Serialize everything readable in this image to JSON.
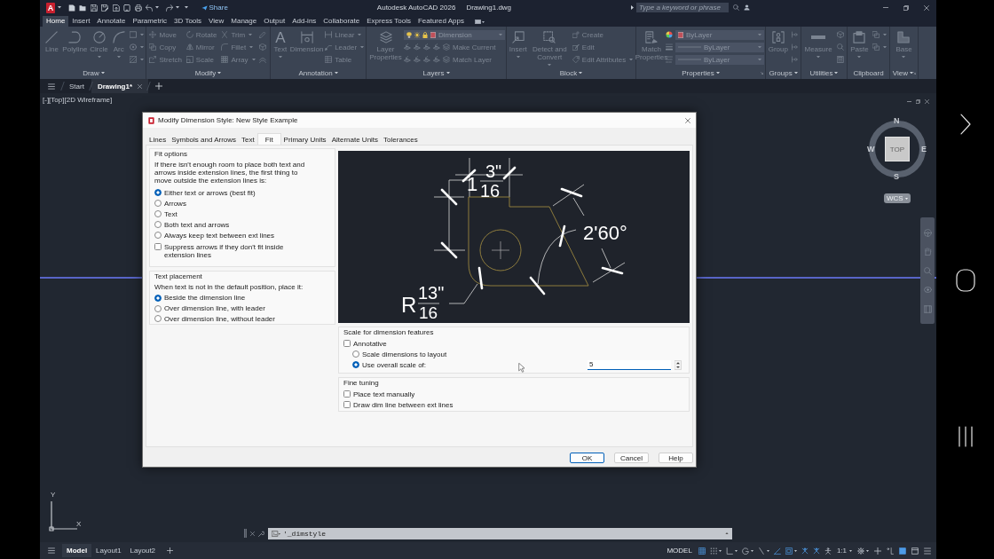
{
  "title_bar": {
    "logo": "A",
    "share": "Share",
    "app_title": "Autodesk AutoCAD 2026",
    "file_name": "Drawing1.dwg",
    "search": {
      "placeholder": "Type a keyword or phrase"
    }
  },
  "ribbon_tabs": [
    {
      "label": "Home",
      "selected": true
    },
    {
      "label": "Insert",
      "selected": false
    },
    {
      "label": "Annotate",
      "selected": false
    },
    {
      "label": "Parametric",
      "selected": false
    },
    {
      "label": "3D Tools",
      "selected": false
    },
    {
      "label": "View",
      "selected": false
    },
    {
      "label": "Manage",
      "selected": false
    },
    {
      "label": "Output",
      "selected": false
    },
    {
      "label": "Add-ins",
      "selected": false
    },
    {
      "label": "Collaborate",
      "selected": false
    },
    {
      "label": "Express Tools",
      "selected": false
    },
    {
      "label": "Featured Apps",
      "selected": false
    }
  ],
  "ribbon_panels": [
    {
      "title": "Draw",
      "dropdown": true,
      "columns": [
        {
          "kind": "large",
          "label": "Line",
          "dropdown": false
        },
        {
          "kind": "large",
          "label": "Polyline",
          "dropdown": false
        },
        {
          "kind": "large",
          "label": "Circle",
          "dropdown": true
        },
        {
          "kind": "large",
          "label": "Arc",
          "dropdown": true
        },
        {
          "kind": "stack",
          "rows": [
            {
              "kind": "tool",
              "dropdown": true
            },
            {
              "kind": "tool",
              "dropdown": true
            },
            {
              "kind": "tool",
              "dropdown": true
            }
          ]
        }
      ]
    },
    {
      "title": "Modify",
      "dropdown": true,
      "columns": [
        {
          "kind": "stack",
          "rows": [
            {
              "kind": "tool",
              "label": "Move",
              "dropdown": false
            },
            {
              "kind": "tool",
              "label": "Copy",
              "dropdown": false
            },
            {
              "kind": "tool",
              "label": "Stretch",
              "dropdown": false
            }
          ]
        },
        {
          "kind": "stack",
          "rows": [
            {
              "kind": "tool",
              "label": "Rotate",
              "dropdown": false
            },
            {
              "kind": "tool",
              "label": "Mirror",
              "dropdown": false
            },
            {
              "kind": "tool",
              "label": "Scale",
              "dropdown": false
            }
          ]
        },
        {
          "kind": "stack",
          "rows": [
            {
              "kind": "tool",
              "label": "Trim",
              "dropdown": true
            },
            {
              "kind": "tool",
              "label": "Fillet",
              "dropdown": true
            },
            {
              "kind": "tool",
              "label": "Array",
              "dropdown": true
            }
          ]
        },
        {
          "kind": "stack",
          "rows": [
            {
              "kind": "tool",
              "dropdown": false
            },
            {
              "kind": "tool",
              "dropdown": false
            },
            {
              "kind": "tool",
              "dropdown": false
            }
          ]
        }
      ]
    },
    {
      "title": "Annotation",
      "dropdown": true,
      "columns": [
        {
          "kind": "large",
          "glyph": "A",
          "label": "Text",
          "dropdown": true
        },
        {
          "kind": "large",
          "label": "Dimension",
          "dropdown": false
        },
        {
          "kind": "stack",
          "rows": [
            {
              "kind": "tool",
              "label": "Linear",
              "dropdown": true
            },
            {
              "kind": "tool",
              "label": "Leader",
              "dropdown": true
            },
            {
              "kind": "tool",
              "label": "Table",
              "dropdown": false
            }
          ]
        }
      ]
    },
    {
      "title": "Layers",
      "dropdown": true,
      "columns": [
        {
          "kind": "large",
          "label": "Layer Properties",
          "dropdown": false
        },
        {
          "kind": "stack",
          "rows": [
            {
              "kind": "combo",
              "label": "Dimension",
              "dropdown": true
            },
            {
              "kind": "tool",
              "label": "Make Current",
              "dropdown": false
            },
            {
              "kind": "tool",
              "label": "Match Layer",
              "dropdown": false
            }
          ]
        }
      ]
    },
    {
      "title": "Block",
      "dropdown": true,
      "columns": [
        {
          "kind": "large",
          "label": "Insert",
          "dropdown": true
        },
        {
          "kind": "large",
          "label": "Detect and Convert",
          "dropdown": true
        },
        {
          "kind": "stack",
          "rows": [
            {
              "kind": "tool",
              "label": "Create",
              "dropdown": false
            },
            {
              "kind": "tool",
              "label": "Edit",
              "dropdown": false
            },
            {
              "kind": "tool",
              "label": "Edit Attributes",
              "dropdown": true
            }
          ]
        }
      ]
    },
    {
      "title": "Properties",
      "dropdown": true,
      "columns": [
        {
          "kind": "large",
          "label": "Match Properties",
          "dropdown": false
        },
        {
          "kind": "stack",
          "rows": [
            {
              "kind": "combo",
              "label": "ByLayer",
              "dropdown": true
            },
            {
              "kind": "combo",
              "label": "ByLayer",
              "dropdown": true
            },
            {
              "kind": "combo",
              "label": "ByLayer",
              "dropdown": true
            }
          ]
        }
      ]
    },
    {
      "title": "Groups",
      "dropdown": true,
      "columns": [
        {
          "kind": "large",
          "label": "Group",
          "dropdown": false
        },
        {
          "kind": "stack",
          "rows": [
            {
              "kind": "tool",
              "dropdown": false
            },
            {
              "kind": "tool",
              "dropdown": false
            },
            {
              "kind": "tool",
              "dropdown": false
            }
          ]
        }
      ]
    },
    {
      "title": "Utilities",
      "dropdown": true,
      "columns": [
        {
          "kind": "large",
          "label": "Measure",
          "dropdown": true
        },
        {
          "kind": "stack",
          "rows": [
            {
              "kind": "tool",
              "dropdown": false
            },
            {
              "kind": "tool",
              "dropdown": false
            },
            {
              "kind": "tool",
              "dropdown": false
            }
          ]
        }
      ]
    },
    {
      "title": "Clipboard",
      "dropdown": false,
      "columns": [
        {
          "kind": "large",
          "label": "Paste",
          "dropdown": true
        },
        {
          "kind": "stack",
          "rows": [
            {
              "kind": "tool",
              "dropdown": true
            },
            {
              "kind": "tool",
              "dropdown": true
            }
          ]
        }
      ]
    },
    {
      "title": "View",
      "dropdown": true,
      "columns": [
        {
          "kind": "large",
          "label": "Base",
          "dropdown": true
        }
      ]
    }
  ],
  "file_tabs": [
    {
      "label": "Start",
      "selected": false
    },
    {
      "label": "Drawing1*",
      "selected": true
    }
  ],
  "viewport": {
    "label": "[-][Top][2D Wireframe]"
  },
  "view_cube": {
    "north": "N",
    "east": "E",
    "south": "S",
    "west": "W",
    "face": "TOP",
    "ucs_menu": "WCS"
  },
  "ucs_icon": {
    "y_label": "Y",
    "x_label": "X"
  },
  "command_line": {
    "value": "'_dimstyle"
  },
  "dialog": {
    "title": "Modify Dimension Style: New Style Example",
    "tabs": [
      {
        "label": "Lines",
        "selected": false
      },
      {
        "label": "Symbols and Arrows",
        "selected": false
      },
      {
        "label": "Text",
        "selected": false
      },
      {
        "label": "Fit",
        "selected": true
      },
      {
        "label": "Primary Units",
        "selected": false
      },
      {
        "label": "Alternate Units",
        "selected": false
      },
      {
        "label": "Tolerances",
        "selected": false
      }
    ],
    "fit_options": {
      "legend": "Fit options",
      "text": "If there isn't enough room to place both text and arrows inside extension lines, the first thing to move outside the extension lines is:",
      "options": [
        {
          "label": "Either text or arrows (best fit)",
          "selected": true
        },
        {
          "label": "Arrows",
          "selected": false
        },
        {
          "label": "Text",
          "selected": false
        },
        {
          "label": "Both text and arrows",
          "selected": false
        },
        {
          "label": "Always keep text between ext lines",
          "selected": false
        }
      ],
      "suppress_arrows": {
        "label": "Suppress arrows if they don't fit inside extension lines",
        "checked": false
      }
    },
    "text_placement": {
      "legend": "Text placement",
      "text": "When text is not in the default position, place it:",
      "options": [
        {
          "label": "Beside the dimension line",
          "selected": true
        },
        {
          "label": "Over dimension line, with leader",
          "selected": false
        },
        {
          "label": "Over dimension line, without leader",
          "selected": false
        }
      ]
    },
    "preview": {
      "labels": [
        "1",
        "3\"",
        "16",
        "2'60°",
        "R",
        "13\"",
        "16"
      ]
    },
    "scale": {
      "legend": "Scale for dimension features",
      "annotative": {
        "label": "Annotative",
        "checked": false
      },
      "options": [
        {
          "label": "Scale dimensions to layout",
          "selected": false
        },
        {
          "label": "Use overall scale of:",
          "selected": true
        }
      ],
      "overall_scale": {
        "value": "5"
      }
    },
    "fine_tuning": {
      "legend": "Fine tuning",
      "checks": [
        {
          "label": "Place text manually",
          "checked": false
        },
        {
          "label": "Draw dim line between ext lines",
          "checked": false
        }
      ]
    },
    "buttons": [
      {
        "label": "OK",
        "focused": true
      },
      {
        "label": "Cancel",
        "focused": false
      },
      {
        "label": "Help",
        "focused": false
      }
    ]
  },
  "status_bar": {
    "layout_tabs": [
      {
        "label": "Model",
        "selected": true
      },
      {
        "label": "Layout1",
        "selected": false
      },
      {
        "label": "Layout2",
        "selected": false
      }
    ],
    "space": "MODEL",
    "toggles": [
      {
        "on": true
      },
      {
        "on": false
      },
      {
        "on": false
      },
      {
        "on": false
      },
      {
        "on": false
      },
      {
        "on": true
      },
      {
        "on": true
      },
      {
        "on": true
      },
      {
        "on": true
      },
      {
        "on": false
      }
    ],
    "scale": "1:1"
  }
}
